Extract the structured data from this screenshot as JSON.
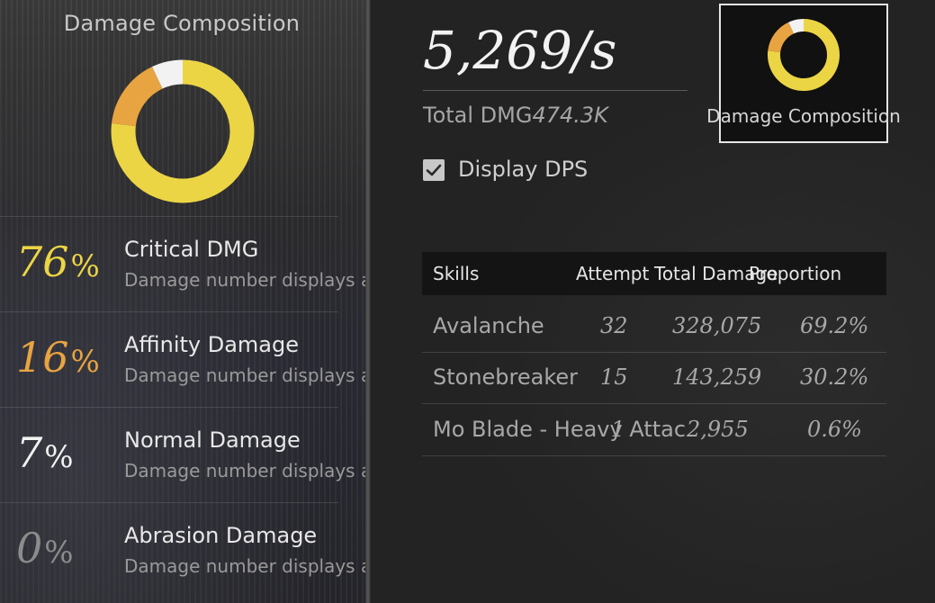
{
  "left": {
    "title": "Damage Composition",
    "stats": [
      {
        "percent": "76",
        "sign": "%",
        "name": "Critical DMG",
        "desc": "Damage number displays as",
        "color": "#ecd545"
      },
      {
        "percent": "16",
        "sign": "%",
        "name": "Affinity Damage",
        "desc": "Damage number displays as",
        "color": "#e8a441"
      },
      {
        "percent": "7",
        "sign": "%",
        "name": "Normal Damage",
        "desc": "Damage number displays as",
        "color": "#f2f2f2"
      },
      {
        "percent": "0",
        "sign": "%",
        "name": "Abrasion Damage",
        "desc": "Damage number displays as",
        "color": "#8c8c8c"
      }
    ]
  },
  "summary": {
    "dps": "5,269/s",
    "total_label": "Total DMG",
    "total_value": "474.3K",
    "display_dps_label": "Display DPS",
    "display_dps_checked": true,
    "composition_button_label": "Damage Composition"
  },
  "table": {
    "headers": {
      "skills": "Skills",
      "attempt": "Attempt",
      "total": "Total Damage",
      "proportion": "Proportion"
    },
    "rows": [
      {
        "skill": "Avalanche",
        "attempt": "32",
        "total": "328,075",
        "proportion": "69.2%"
      },
      {
        "skill": "Stonebreaker",
        "attempt": "15",
        "total": "143,259",
        "proportion": "30.2%"
      },
      {
        "skill": "Mo Blade - Heavy Attack",
        "attempt": "1",
        "total": "2,955",
        "proportion": "0.6%"
      }
    ]
  },
  "colors": {
    "critical": "#ecd545",
    "affinity": "#e8a441",
    "normal": "#f2f2f2",
    "abrasion": "#8c8c8c"
  }
}
